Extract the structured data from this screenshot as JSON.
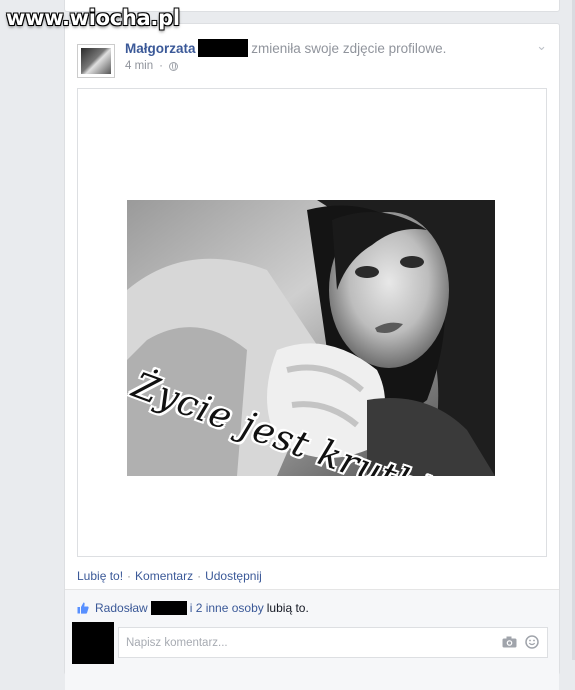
{
  "watermark": {
    "text": "www.wiocha.pl"
  },
  "post": {
    "author": "Małgorzata",
    "action_text": "zmieniła swoje zdjęcie profilowe.",
    "time": "4 min",
    "privacy_icon": "globe-icon",
    "menu_icon": "chevron-down-icon",
    "photo_caption": "Życie jest krutkie...",
    "actions": {
      "like": "Lubię to!",
      "comment": "Komentarz",
      "share": "Udostępnij",
      "separator": "·"
    }
  },
  "likes": {
    "first_liker": "Radosław",
    "others": "i 2 inne osoby",
    "suffix": "lubią to."
  },
  "comment_input": {
    "placeholder": "Napisz komentarz...",
    "camera_icon": "camera-icon",
    "emoji_icon": "smiley-icon"
  },
  "colors": {
    "link": "#3b5998",
    "meta": "#90949c",
    "background": "#e9ebee"
  }
}
